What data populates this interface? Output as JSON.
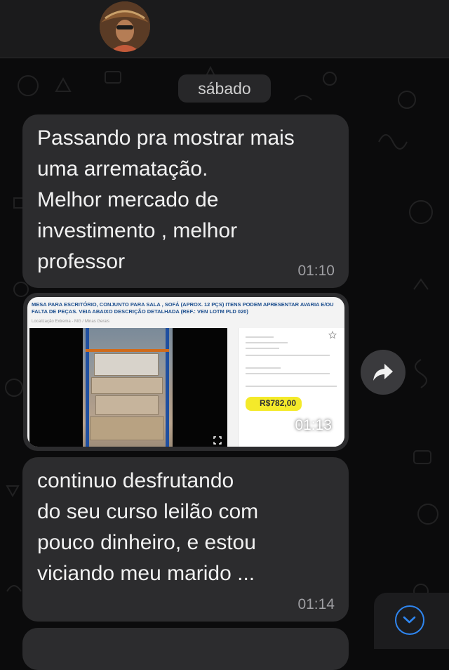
{
  "date_separator": "sábado",
  "messages": [
    {
      "text": "Passando pra mostrar mais\numa arrematação.\nMelhor mercado de\ninvestimento , melhor\nprofessor",
      "time": "01:10"
    },
    {
      "type": "image",
      "time": "01:13",
      "screenshot_title": "MESA PARA ESCRITÓRIO, CONJUNTO PARA SALA , SOFÁ (APROX. 12 PÇS) ITENS PODEM APRESENTAR AVARIA E/OU FALTA DE PEÇAS. VEIA ABAIXO DESCRIÇÃO DETALHADA (Ref.: VEN LOTM PLD 020)",
      "screenshot_location": "Localização Extrema - MG / Minas Gerais",
      "price": "R$782,00"
    },
    {
      "text": "        continuo desfrutando\ndo seu curso leilão com\npouco dinheiro, e estou\nviciando meu marido ...",
      "time": "01:14"
    },
    {
      "text": "",
      "time": ""
    }
  ],
  "icons": {
    "avatar": "contact-avatar",
    "forward": "forward-arrow-icon",
    "scroll": "chevron-down-icon",
    "expand": "expand-icon",
    "star": "star-icon"
  },
  "colors": {
    "background": "#0b0b0c",
    "bubble": "#2c2c2e",
    "accent": "#2f86f0",
    "price_highlight": "#f4ea2a"
  }
}
